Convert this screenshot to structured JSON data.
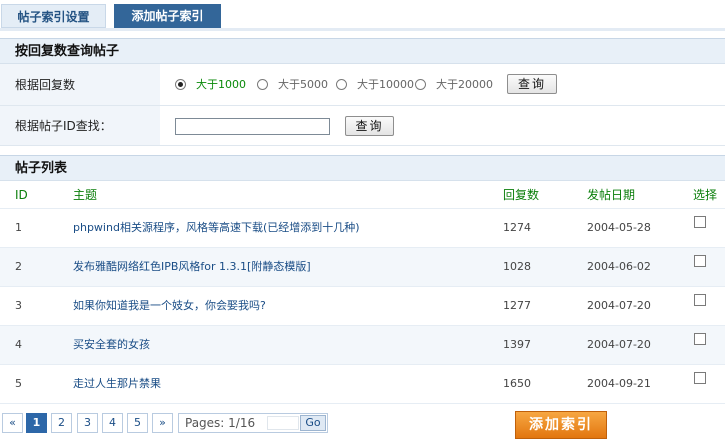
{
  "tabs": [
    {
      "label": "帖子索引设置"
    },
    {
      "label": "添加帖子索引"
    }
  ],
  "search_section": {
    "title": "按回复数查询帖子",
    "reply_row": {
      "label": "根据回复数",
      "options": [
        {
          "label": "大于1000",
          "selected": true
        },
        {
          "label": "大于5000",
          "selected": false
        },
        {
          "label": "大于10000",
          "selected": false
        },
        {
          "label": "大于20000",
          "selected": false
        }
      ],
      "button": "查询"
    },
    "id_row": {
      "label": "根据帖子ID查找：",
      "input_value": "",
      "button": "查询"
    }
  },
  "list_section": {
    "title": "帖子列表",
    "columns": {
      "id": "ID",
      "subject": "主题",
      "replies": "回复数",
      "date": "发帖日期",
      "select": "选择"
    },
    "rows": [
      {
        "id": "1",
        "subject": "phpwind相关源程序，风格等高速下载(已经增添到十几种)",
        "replies": "1274",
        "date": "2004-05-28"
      },
      {
        "id": "2",
        "subject": "发布雅酷网络红色IPB风格for 1.3.1[附静态模版]",
        "replies": "1028",
        "date": "2004-06-02"
      },
      {
        "id": "3",
        "subject": "如果你知道我是一个妓女，你会娶我吗?",
        "replies": "1277",
        "date": "2004-07-20"
      },
      {
        "id": "4",
        "subject": "买安全套的女孩",
        "replies": "1397",
        "date": "2004-07-20"
      },
      {
        "id": "5",
        "subject": "走过人生那片禁果",
        "replies": "1650",
        "date": "2004-09-21"
      }
    ]
  },
  "pagination": {
    "first": "«",
    "pages": [
      "1",
      "2",
      "3",
      "4",
      "5"
    ],
    "current": "1",
    "last": "»",
    "info": "Pages: 1/16",
    "go": "Go"
  },
  "add_button": "添加索引"
}
